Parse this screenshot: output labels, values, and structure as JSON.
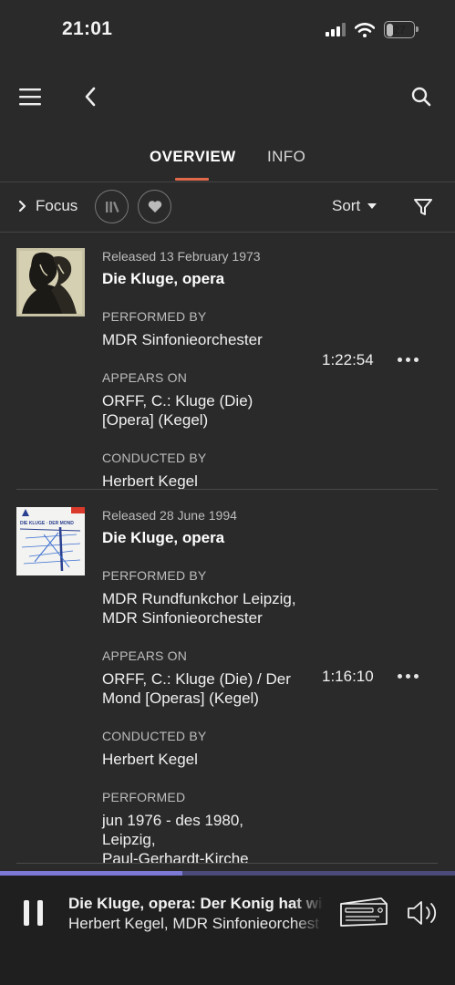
{
  "status": {
    "time": "21:01",
    "battery": "27",
    "battery_level": 0.27
  },
  "tabs": [
    {
      "label": "OVERVIEW",
      "active": true
    },
    {
      "label": "INFO",
      "active": false
    }
  ],
  "filter": {
    "focus_label": "Focus",
    "sort_label": "Sort"
  },
  "releases": [
    {
      "date": "Released 13 February 1973",
      "title": "Die Kluge, opera",
      "performed_by_label": "PERFORMED BY",
      "performed_by": "MDR Sinfonieorchester",
      "appears_on_label": "APPEARS ON",
      "appears_on": "ORFF, C.: Kluge (Die)\n[Opera] (Kegel)",
      "conducted_by_label": "CONDUCTED BY",
      "conducted_by": "Herbert Kegel",
      "duration": "1:22:54"
    },
    {
      "date": "Released 28 June 1994",
      "title": "Die Kluge, opera",
      "performed_by_label": "PERFORMED BY",
      "performed_by": "MDR Rundfunkchor Leipzig,\nMDR Sinfonieorchester",
      "appears_on_label": "APPEARS ON",
      "appears_on": "ORFF, C.: Kluge (Die) / Der\nMond [Operas] (Kegel)",
      "conducted_by_label": "CONDUCTED BY",
      "conducted_by": "Herbert Kegel",
      "performed_label": "PERFORMED",
      "performed": "jun 1976 - des 1980,\nLeipzig,\nPaul-Gerhardt-Kirche",
      "duration": "1:16:10",
      "cover_text": "DIE KLUGE · DER MOND"
    }
  ],
  "player": {
    "title": "Die Kluge, opera: Der Konig hat wie",
    "artist": "Herbert Kegel, MDR Sinfonieorchest",
    "progress": 0.4
  },
  "colors": {
    "accent": "#e06a4a",
    "progress": "#7c7ad6",
    "background": "#2a2a2b"
  }
}
